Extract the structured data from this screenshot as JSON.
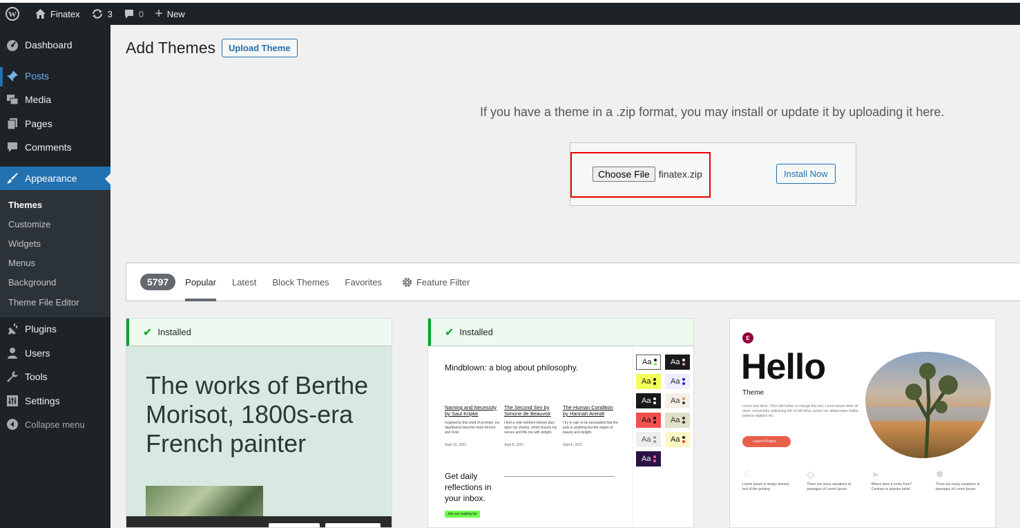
{
  "adminbar": {
    "site_name": "Finatex",
    "updates_count": "3",
    "comments_count": "0",
    "new_label": "New"
  },
  "sidebar": {
    "items": [
      {
        "label": "Dashboard",
        "icon": "dashboard-icon"
      },
      {
        "label": "Posts",
        "icon": "pin-icon"
      },
      {
        "label": "Media",
        "icon": "media-icon"
      },
      {
        "label": "Pages",
        "icon": "pages-icon"
      },
      {
        "label": "Comments",
        "icon": "comment-icon"
      },
      {
        "label": "Appearance",
        "icon": "brush-icon"
      }
    ],
    "submenu": [
      "Themes",
      "Customize",
      "Widgets",
      "Menus",
      "Background",
      "Theme File Editor"
    ],
    "items_after": [
      {
        "label": "Plugins",
        "icon": "plug-icon"
      },
      {
        "label": "Users",
        "icon": "user-icon"
      },
      {
        "label": "Tools",
        "icon": "wrench-icon"
      },
      {
        "label": "Settings",
        "icon": "settings-icon"
      }
    ],
    "collapse_label": "Collapse menu"
  },
  "main": {
    "page_title": "Add Themes",
    "upload_button": "Upload Theme",
    "upload_description": "If you have a theme in a .zip format, you may install or update it by uploading it here.",
    "choose_file_label": "Choose File",
    "chosen_file": "finatex.zip",
    "install_button": "Install Now"
  },
  "filter": {
    "count": "5797",
    "tabs": [
      "Popular",
      "Latest",
      "Block Themes",
      "Favorites"
    ],
    "active_tab": "Popular",
    "feature_filter": "Feature Filter"
  },
  "cards": {
    "installed_label": "Installed",
    "card1": {
      "headline": "The works of Berthe Morisot, 1800s-era French painter"
    },
    "card2": {
      "headline": "Mindblown: a blog about philosophy.",
      "posts": [
        {
          "title": "Naming and Necessity by Saul Kripke",
          "excerpt": "Inspired by this wind of promise, my daydreams become more fervent and vivid.",
          "date": "Sept 10, 2021"
        },
        {
          "title": "The Second Sex by Simone de Beauvoir",
          "excerpt": "I feel a cold northern breeze play upon my cheeks, which braces my nerves and fills me with delight.",
          "date": "Sept 8, 2021"
        },
        {
          "title": "The Human Condition by Hannah Arendt",
          "excerpt": "I try in vain to be persuaded that the pole is anything but the region of beauty and delight.",
          "date": "Sept 6, 2021"
        }
      ],
      "daily": "Get daily reflections in your inbox.",
      "join": "Join our mailing list",
      "swatch_label": "Aa"
    },
    "card3": {
      "hello": "Hello",
      "theme": "Theme",
      "lorem": "Lorem text block. Click edit button to change this text. Lorem ipsum dolor sit amet, consectetur adipiscing elit. Ut elit tellus, luctus nec ullamcorper mattis, pulvinar dapibus leo.",
      "launch": "Launch Project →",
      "features": [
        "Lorem Ipsum is simply dummy text of the printing",
        "There are many variations of passages of Lorem Ipsum",
        "Where does it come from? Contrary to popular belief",
        "There are many variations of passages of Lorem Ipsum"
      ]
    }
  },
  "colors": {
    "accent": "#2271b1",
    "sidebar_bg": "#1d2327",
    "highlight": "#e00000",
    "installed_green": "#00a32a"
  }
}
